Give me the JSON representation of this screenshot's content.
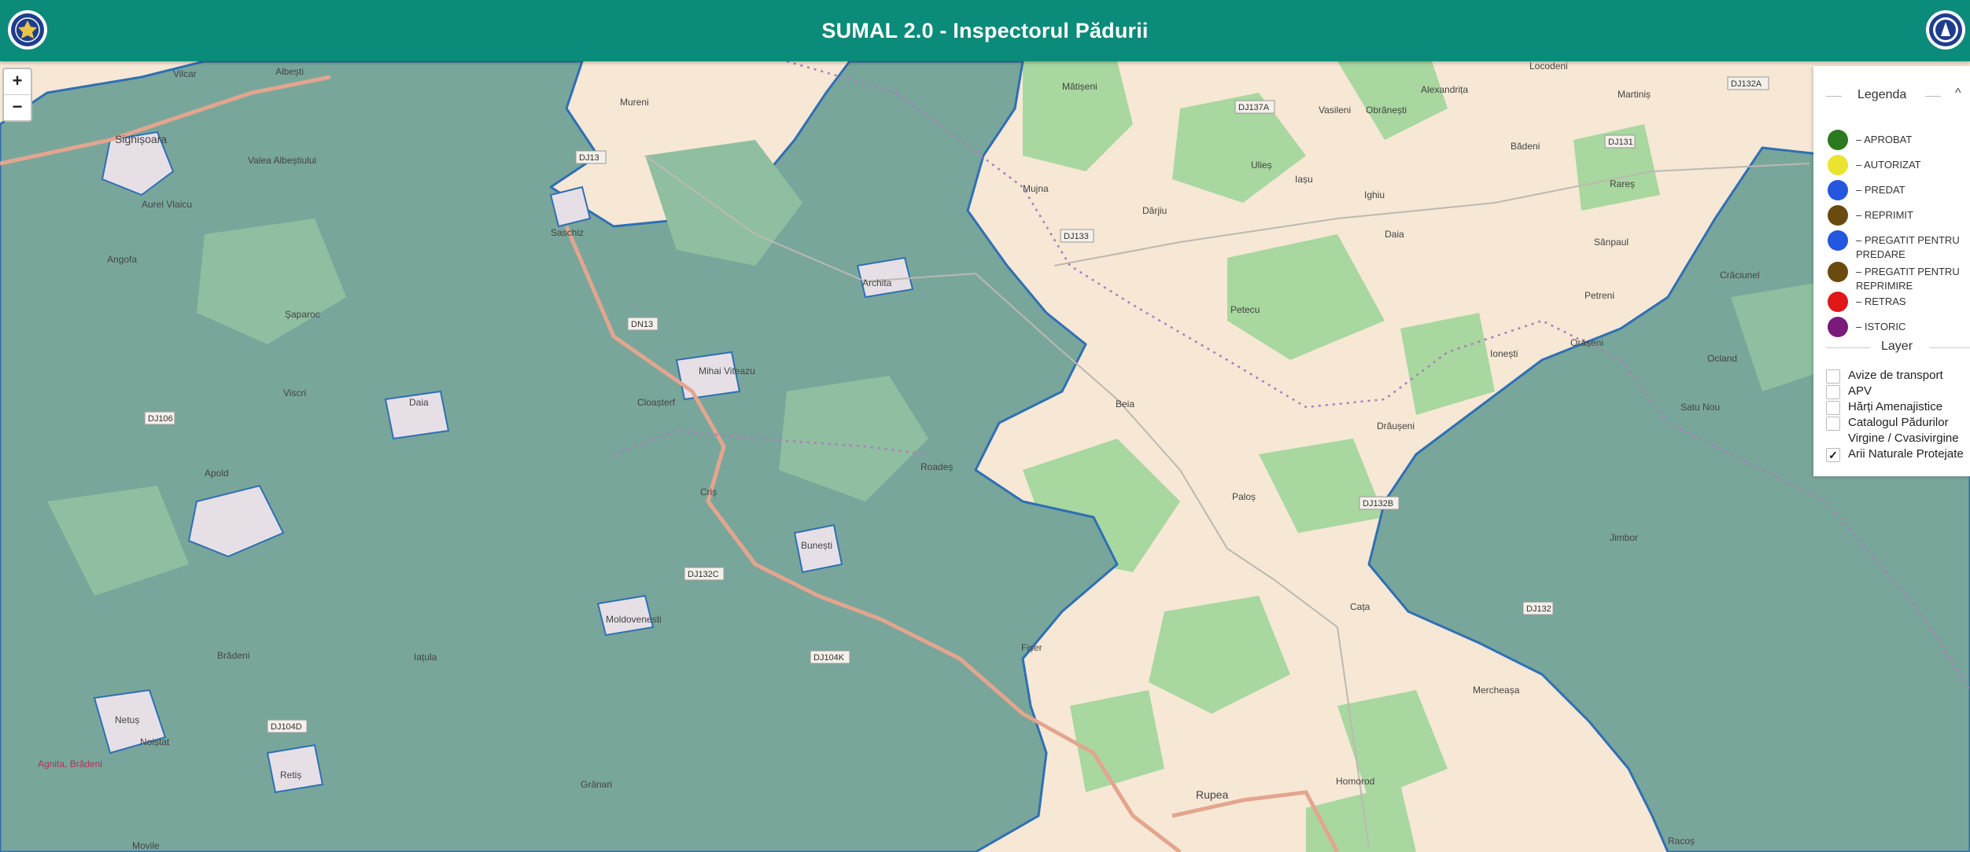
{
  "header": {
    "title": "SUMAL 2.0 - Inspectorul Pădurii",
    "left_logo": "romanian-government-logo-icon",
    "right_logo": "inspectorate-logo-icon"
  },
  "zoom": {
    "in": "+",
    "out": "−"
  },
  "legend": {
    "title": "Legenda",
    "collapse_icon": "^",
    "statuses": [
      {
        "label": "– APROBAT",
        "color": "#2a7a1e"
      },
      {
        "label": "– AUTORIZAT",
        "color": "#eae330"
      },
      {
        "label": "– PREDAT",
        "color": "#2456e0"
      },
      {
        "label": "– REPRIMIT",
        "color": "#6b4a10"
      },
      {
        "label": "– PREGATIT PENTRU PREDARE",
        "color": "#2456e0"
      },
      {
        "label": "– PREGATIT PENTRU REPRIMIRE",
        "color": "#6b4a10"
      },
      {
        "label": "– RETRAS",
        "color": "#e01818"
      },
      {
        "label": "– ISTORIC",
        "color": "#7a1a7a"
      }
    ],
    "layer_title": "Layer",
    "layers": [
      {
        "label": "Avize de transport",
        "checked": false
      },
      {
        "label": "APV",
        "checked": false
      },
      {
        "label": "Hărți Amenajistice",
        "checked": false
      },
      {
        "label": "Catalogul Pădurilor Virgine / Cvasivirgine",
        "checked": false
      },
      {
        "label": "Arii Naturale Protejate",
        "checked": true
      }
    ]
  },
  "map": {
    "colors": {
      "forest": "#8fc79a",
      "protected": "#7aa89a",
      "farmland": "#f6e8d4",
      "border": "#2f6fb5",
      "road": "#e3a58f"
    },
    "places": [
      {
        "name": "Albești"
      },
      {
        "name": "Vilcar"
      },
      {
        "name": "Sighișoara"
      },
      {
        "name": "Valea Albeștiului"
      },
      {
        "name": "Aurel Vlaicu"
      },
      {
        "name": "Angofa"
      },
      {
        "name": "Șaparoc"
      },
      {
        "name": "Viscri"
      },
      {
        "name": "Daia"
      },
      {
        "name": "Apold"
      },
      {
        "name": "Brădeni"
      },
      {
        "name": "Netuș"
      },
      {
        "name": "Noiștat"
      },
      {
        "name": "Agnita, Brădeni"
      },
      {
        "name": "Retiș"
      },
      {
        "name": "Movile"
      },
      {
        "name": "Grânari"
      },
      {
        "name": "Iațula"
      },
      {
        "name": "Moldovenesti"
      },
      {
        "name": "Saschiz"
      },
      {
        "name": "Mureni"
      },
      {
        "name": "Archita"
      },
      {
        "name": "Mihai Viteazu"
      },
      {
        "name": "Cloașterf"
      },
      {
        "name": "Criș"
      },
      {
        "name": "Bunești"
      },
      {
        "name": "Roadeș"
      },
      {
        "name": "Fișer"
      },
      {
        "name": "Mătișeni"
      },
      {
        "name": "Mujna"
      },
      {
        "name": "Dârjiu"
      },
      {
        "name": "Ulieș"
      },
      {
        "name": "Vasileni"
      },
      {
        "name": "Obrănești"
      },
      {
        "name": "Alexandrița"
      },
      {
        "name": "Iașu"
      },
      {
        "name": "Ighiu"
      },
      {
        "name": "Daia"
      },
      {
        "name": "Petecu"
      },
      {
        "name": "Beia"
      },
      {
        "name": "Paloș"
      },
      {
        "name": "Drăușeni"
      },
      {
        "name": "Ionești"
      },
      {
        "name": "Cața"
      },
      {
        "name": "Mercheașa"
      },
      {
        "name": "Homorod"
      },
      {
        "name": "Rupea"
      },
      {
        "name": "Bădeni"
      },
      {
        "name": "Martiniș"
      },
      {
        "name": "Locodeni"
      },
      {
        "name": "Rareș"
      },
      {
        "name": "Sânpaul"
      },
      {
        "name": "Petreni"
      },
      {
        "name": "Orășeni"
      },
      {
        "name": "Crăciunel"
      },
      {
        "name": "Ocland"
      },
      {
        "name": "Satu Nou"
      },
      {
        "name": "Jimbor"
      },
      {
        "name": "Racoș"
      }
    ],
    "roads": [
      {
        "name": "DJ13"
      },
      {
        "name": "DN13"
      },
      {
        "name": "DJ133"
      },
      {
        "name": "DJ137A"
      },
      {
        "name": "DJ132B"
      },
      {
        "name": "DJ132C"
      },
      {
        "name": "DJ104K"
      },
      {
        "name": "DJ104D"
      },
      {
        "name": "DJ132A"
      },
      {
        "name": "DJ131"
      },
      {
        "name": "DJ132"
      },
      {
        "name": "DJ106"
      }
    ]
  }
}
